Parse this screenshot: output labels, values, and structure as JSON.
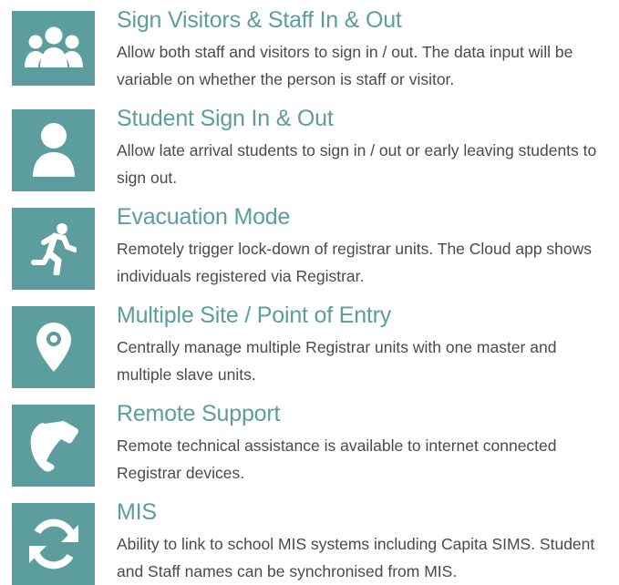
{
  "colors": {
    "accent": "#5b9e9d",
    "title_text": "#5b9e9d",
    "body_text": "#4a4a4a",
    "icon": "#ffffff"
  },
  "features": [
    {
      "icon": "group-people-icon",
      "title": "Sign Visitors & Staff In & Out",
      "description": "Allow both staff and visitors to sign in / out. The data input will be variable on whether the person is staff or visitor."
    },
    {
      "icon": "person-icon",
      "title": "Student Sign In & Out",
      "description": "Allow late arrival students to sign in / out or early leaving students to sign out."
    },
    {
      "icon": "running-person-icon",
      "title": "Evacuation Mode",
      "description": "Remotely trigger lock-down of registrar units. The Cloud app shows individuals registered via Registrar."
    },
    {
      "icon": "location-pin-icon",
      "title": "Multiple Site / Point of Entry",
      "description": "Centrally manage multiple Registrar units with one master and multiple slave units."
    },
    {
      "icon": "phone-handset-icon",
      "title": "Remote Support",
      "description": "Remote technical assistance is available to internet connected Registrar devices."
    },
    {
      "icon": "sync-arrows-icon",
      "title": "MIS",
      "description": "Ability to link to school MIS systems including Capita SIMS. Student and Staff names can be synchronised from MIS."
    }
  ]
}
